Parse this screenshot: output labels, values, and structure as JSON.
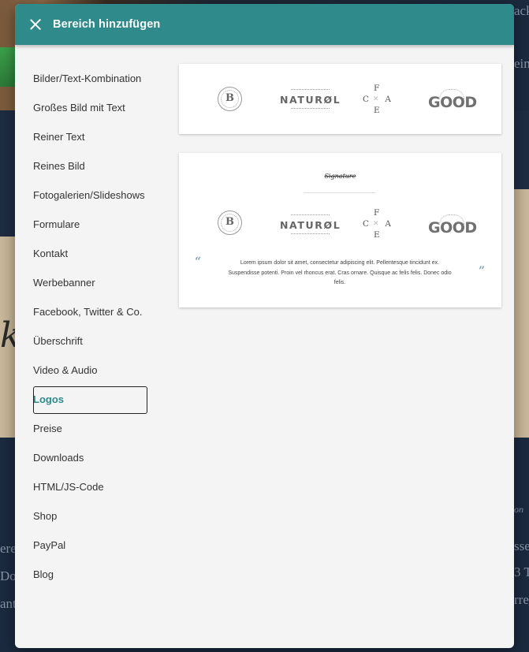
{
  "modal": {
    "title": "Bereich hinzufügen"
  },
  "nav": {
    "items": [
      "Bilder/Text-Kombination",
      "Großes Bild mit Text",
      "Reiner Text",
      "Reines Bild",
      "Fotogalerien/Slideshows",
      "Formulare",
      "Kontakt",
      "Werbebanner",
      "Facebook, Twitter & Co.",
      "Überschrift",
      "Video & Audio",
      "Logos",
      "Preise",
      "Downloads",
      "HTML/JS-Code",
      "Shop",
      "PayPal",
      "Blog"
    ],
    "active": "Logos"
  },
  "logos": {
    "b": "B",
    "naturol": "NATURØL",
    "cafe": {
      "f": "F",
      "c": "C",
      "a": "A",
      "e": "E",
      "k": "✕"
    },
    "good": "GOOD"
  },
  "preview2": {
    "signature": "Signature",
    "quote_open": "“",
    "quote_close": "”",
    "quote": "Lorem ipsum dolor sit amet, consectetur adipiscing elit. Pellentesque tincidunt ex. Suspendisse potenti. Proin vel rhoncus erat. Cras ornare. Quisque ac felis felis. Donec odio felis."
  },
  "background": {
    "fragments": [
      "ack",
      "ein",
      "on",
      "ere",
      "Do",
      "ant",
      "sse",
      "3 Te",
      "rre",
      "ki"
    ]
  },
  "colors": {
    "accent": "#2f8a8c",
    "background": "#1b2a3f",
    "panel": "#f4f4f4"
  }
}
